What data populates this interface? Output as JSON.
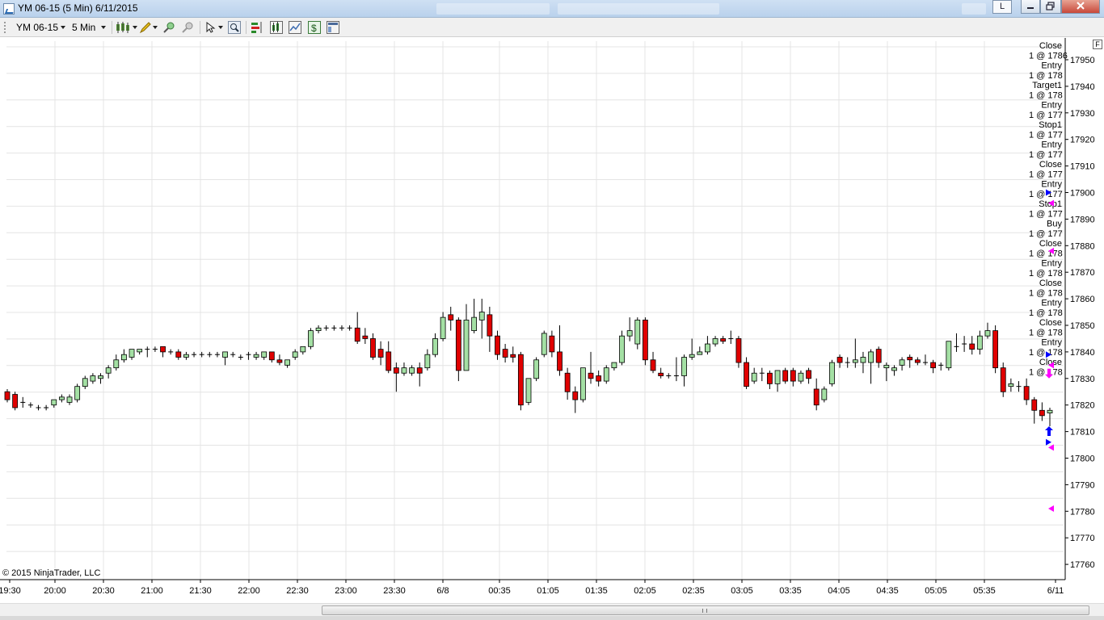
{
  "window": {
    "title": "YM 06-15 (5 Min)  6/11/2015",
    "l_button": "L"
  },
  "toolbar": {
    "instrument": "YM 06-15",
    "interval": "5 Min",
    "icons": [
      "chart-style-icon",
      "drawing-pencil-icon",
      "zoom-in-icon",
      "zoom-out-icon",
      "cursor-icon",
      "magnifier-icon",
      "strategy-icon",
      "indicator-icon",
      "data-box-icon",
      "dollar-icon",
      "properties-icon"
    ]
  },
  "chart": {
    "copyright": "© 2015 NinjaTrader, LLC",
    "panel_toggle": "F",
    "colors": {
      "up": "#a4e0a4",
      "down": "#e00000",
      "wick": "#000000",
      "grid": "#e4e4e4",
      "buy_marker": "#0000ff",
      "sell_marker": "#ff00ff"
    },
    "y_labels": [
      "17950",
      "17940",
      "17930",
      "17920",
      "17910",
      "17900",
      "17890",
      "17880",
      "17870",
      "17860",
      "17850",
      "17840",
      "17830",
      "17820",
      "17810",
      "17800",
      "17790",
      "17780",
      "17770",
      "17760"
    ],
    "x_labels": [
      "19:30",
      "20:00",
      "20:30",
      "21:00",
      "21:30",
      "22:00",
      "22:30",
      "23:00",
      "23:30",
      "6/8",
      "00:35",
      "01:05",
      "01:35",
      "02:05",
      "02:35",
      "03:05",
      "03:35",
      "04:05",
      "04:35",
      "05:05",
      "05:35",
      "6/11"
    ],
    "execution_labels": [
      "Close",
      "1 @ 1786",
      "Entry",
      "1 @ 178",
      "Target1",
      "1 @ 178",
      "Entry",
      "1 @ 177",
      "Stop1",
      "1 @ 177",
      "Entry",
      "1 @ 177",
      "Close",
      "1 @ 177",
      "Entry",
      "1 @ 177",
      "Stop1",
      "1 @ 177",
      "Buy",
      "1 @ 177",
      "Close",
      "1 @ 178",
      "Entry",
      "1 @ 178",
      "Close",
      "1 @ 178",
      "Entry",
      "1 @ 178",
      "Close",
      "1 @ 178",
      "Entry",
      "1 @ 178",
      "Close",
      "1 @ 178"
    ]
  },
  "chart_data": {
    "type": "candlestick",
    "title": "YM 06-15 (5 Min)",
    "ylim": [
      17755,
      17960
    ],
    "candles": [
      {
        "o": 17825,
        "h": 17826,
        "c": 17822,
        "l": 17821
      },
      {
        "o": 17824,
        "h": 17825,
        "c": 17819,
        "l": 17818
      },
      {
        "o": 17821,
        "h": 17823,
        "c": 17821,
        "l": 17819
      },
      {
        "o": 17820,
        "h": 17821,
        "c": 17820,
        "l": 17819
      },
      {
        "o": 17819,
        "h": 17820,
        "c": 17819,
        "l": 17818
      },
      {
        "o": 17819,
        "h": 17820,
        "c": 17819,
        "l": 17818
      },
      {
        "o": 17820,
        "h": 17822,
        "c": 17822,
        "l": 17819
      },
      {
        "o": 17822,
        "h": 17824,
        "c": 17823,
        "l": 17821
      },
      {
        "o": 17821,
        "h": 17824,
        "c": 17823,
        "l": 17820
      },
      {
        "o": 17822,
        "h": 17828,
        "c": 17827,
        "l": 17821
      },
      {
        "o": 17827,
        "h": 17831,
        "c": 17830,
        "l": 17826
      },
      {
        "o": 17829,
        "h": 17832,
        "c": 17831,
        "l": 17828
      },
      {
        "o": 17830,
        "h": 17832,
        "c": 17831,
        "l": 17828
      },
      {
        "o": 17832,
        "h": 17835,
        "c": 17834,
        "l": 17830
      },
      {
        "o": 17834,
        "h": 17839,
        "c": 17837,
        "l": 17833
      },
      {
        "o": 17837,
        "h": 17841,
        "c": 17839,
        "l": 17836
      },
      {
        "o": 17838,
        "h": 17841,
        "c": 17841,
        "l": 17837
      },
      {
        "o": 17840,
        "h": 17841,
        "c": 17841,
        "l": 17839
      },
      {
        "o": 17841,
        "h": 17842,
        "c": 17841,
        "l": 17838
      },
      {
        "o": 17841,
        "h": 17842,
        "c": 17841,
        "l": 17840
      },
      {
        "o": 17842,
        "h": 17842,
        "c": 17840,
        "l": 17838
      },
      {
        "o": 17840,
        "h": 17841,
        "c": 17840,
        "l": 17839
      },
      {
        "o": 17840,
        "h": 17841,
        "c": 17838,
        "l": 17837
      },
      {
        "o": 17838,
        "h": 17840,
        "c": 17839,
        "l": 17837
      },
      {
        "o": 17839,
        "h": 17840,
        "c": 17839,
        "l": 17838
      },
      {
        "o": 17839,
        "h": 17840,
        "c": 17839,
        "l": 17838
      },
      {
        "o": 17839,
        "h": 17840,
        "c": 17839,
        "l": 17838
      },
      {
        "o": 17839,
        "h": 17840,
        "c": 17839,
        "l": 17838
      },
      {
        "o": 17838,
        "h": 17840,
        "c": 17840,
        "l": 17835
      },
      {
        "o": 17839,
        "h": 17840,
        "c": 17839,
        "l": 17838
      },
      {
        "o": 17838,
        "h": 17839,
        "c": 17838,
        "l": 17837
      },
      {
        "o": 17839,
        "h": 17840,
        "c": 17839,
        "l": 17837
      },
      {
        "o": 17838,
        "h": 17840,
        "c": 17839,
        "l": 17837
      },
      {
        "o": 17838,
        "h": 17840,
        "c": 17840,
        "l": 17837
      },
      {
        "o": 17840,
        "h": 17840,
        "c": 17837,
        "l": 17836
      },
      {
        "o": 17837,
        "h": 17839,
        "c": 17836,
        "l": 17835
      },
      {
        "o": 17835,
        "h": 17837,
        "c": 17837,
        "l": 17834
      },
      {
        "o": 17838,
        "h": 17841,
        "c": 17840,
        "l": 17837
      },
      {
        "o": 17840,
        "h": 17842,
        "c": 17842,
        "l": 17839
      },
      {
        "o": 17842,
        "h": 17849,
        "c": 17848,
        "l": 17841
      },
      {
        "o": 17848,
        "h": 17850,
        "c": 17849,
        "l": 17847
      },
      {
        "o": 17849,
        "h": 17850,
        "c": 17849,
        "l": 17848
      },
      {
        "o": 17849,
        "h": 17850,
        "c": 17849,
        "l": 17848
      },
      {
        "o": 17849,
        "h": 17850,
        "c": 17849,
        "l": 17848
      },
      {
        "o": 17849,
        "h": 17850,
        "c": 17849,
        "l": 17848
      },
      {
        "o": 17849,
        "h": 17855,
        "c": 17844,
        "l": 17843
      },
      {
        "o": 17846,
        "h": 17849,
        "c": 17845,
        "l": 17843
      },
      {
        "o": 17845,
        "h": 17847,
        "c": 17838,
        "l": 17837
      },
      {
        "o": 17841,
        "h": 17844,
        "c": 17838,
        "l": 17835
      },
      {
        "o": 17840,
        "h": 17844,
        "c": 17833,
        "l": 17832
      },
      {
        "o": 17834,
        "h": 17836,
        "c": 17832,
        "l": 17825
      },
      {
        "o": 17832,
        "h": 17836,
        "c": 17834,
        "l": 17831
      },
      {
        "o": 17832,
        "h": 17835,
        "c": 17834,
        "l": 17831
      },
      {
        "o": 17834,
        "h": 17836,
        "c": 17832,
        "l": 17827
      },
      {
        "o": 17834,
        "h": 17841,
        "c": 17839,
        "l": 17833
      },
      {
        "o": 17839,
        "h": 17847,
        "c": 17845,
        "l": 17838
      },
      {
        "o": 17845,
        "h": 17855,
        "c": 17853,
        "l": 17844
      },
      {
        "o": 17854,
        "h": 17857,
        "c": 17852,
        "l": 17848
      },
      {
        "o": 17852,
        "h": 17853,
        "c": 17833,
        "l": 17829
      },
      {
        "o": 17833,
        "h": 17858,
        "c": 17852,
        "l": 17836
      },
      {
        "o": 17848,
        "h": 17860,
        "c": 17853,
        "l": 17847
      },
      {
        "o": 17852,
        "h": 17860,
        "c": 17855,
        "l": 17845
      },
      {
        "o": 17854,
        "h": 17857,
        "c": 17846,
        "l": 17840
      },
      {
        "o": 17846,
        "h": 17848,
        "c": 17839,
        "l": 17837
      },
      {
        "o": 17841,
        "h": 17843,
        "c": 17838,
        "l": 17836
      },
      {
        "o": 17839,
        "h": 17842,
        "c": 17838,
        "l": 17836
      },
      {
        "o": 17839,
        "h": 17840,
        "c": 17820,
        "l": 17818
      },
      {
        "o": 17821,
        "h": 17830,
        "c": 17830,
        "l": 17820
      },
      {
        "o": 17830,
        "h": 17838,
        "c": 17837,
        "l": 17829
      },
      {
        "o": 17839,
        "h": 17848,
        "c": 17847,
        "l": 17838
      },
      {
        "o": 17846,
        "h": 17848,
        "c": 17840,
        "l": 17838
      },
      {
        "o": 17840,
        "h": 17850,
        "c": 17833,
        "l": 17831
      },
      {
        "o": 17832,
        "h": 17834,
        "c": 17825,
        "l": 17822
      },
      {
        "o": 17825,
        "h": 17827,
        "c": 17822,
        "l": 17817
      },
      {
        "o": 17822,
        "h": 17834,
        "c": 17834,
        "l": 17821
      },
      {
        "o": 17832,
        "h": 17840,
        "c": 17830,
        "l": 17828
      },
      {
        "o": 17831,
        "h": 17833,
        "c": 17829,
        "l": 17827
      },
      {
        "o": 17829,
        "h": 17835,
        "c": 17834,
        "l": 17828
      },
      {
        "o": 17834,
        "h": 17836,
        "c": 17836,
        "l": 17833
      },
      {
        "o": 17836,
        "h": 17848,
        "c": 17846,
        "l": 17835
      },
      {
        "o": 17846,
        "h": 17853,
        "c": 17848,
        "l": 17844
      },
      {
        "o": 17843,
        "h": 17853,
        "c": 17852,
        "l": 17841
      },
      {
        "o": 17852,
        "h": 17853,
        "c": 17837,
        "l": 17835
      },
      {
        "o": 17837,
        "h": 17840,
        "c": 17833,
        "l": 17832
      },
      {
        "o": 17832,
        "h": 17834,
        "c": 17831,
        "l": 17830
      },
      {
        "o": 17831,
        "h": 17832,
        "c": 17831,
        "l": 17830
      },
      {
        "o": 17831,
        "h": 17838,
        "c": 17831,
        "l": 17829
      },
      {
        "o": 17831,
        "h": 17839,
        "c": 17838,
        "l": 17827
      },
      {
        "o": 17838,
        "h": 17845,
        "c": 17839,
        "l": 17837
      },
      {
        "o": 17839,
        "h": 17842,
        "c": 17840,
        "l": 17839
      },
      {
        "o": 17840,
        "h": 17846,
        "c": 17843,
        "l": 17839
      },
      {
        "o": 17843,
        "h": 17846,
        "c": 17845,
        "l": 17842
      },
      {
        "o": 17845,
        "h": 17846,
        "c": 17844,
        "l": 17843
      },
      {
        "o": 17845,
        "h": 17848,
        "c": 17845,
        "l": 17843
      },
      {
        "o": 17845,
        "h": 17846,
        "c": 17836,
        "l": 17834
      },
      {
        "o": 17836,
        "h": 17838,
        "c": 17827,
        "l": 17826
      },
      {
        "o": 17829,
        "h": 17834,
        "c": 17832,
        "l": 17828
      },
      {
        "o": 17832,
        "h": 17834,
        "c": 17832,
        "l": 17829
      },
      {
        "o": 17832,
        "h": 17833,
        "c": 17828,
        "l": 17826
      },
      {
        "o": 17828,
        "h": 17833,
        "c": 17833,
        "l": 17825
      },
      {
        "o": 17833,
        "h": 17834,
        "c": 17829,
        "l": 17828
      },
      {
        "o": 17833,
        "h": 17834,
        "c": 17829,
        "l": 17827
      },
      {
        "o": 17829,
        "h": 17833,
        "c": 17832,
        "l": 17828
      },
      {
        "o": 17833,
        "h": 17834,
        "c": 17830,
        "l": 17828
      },
      {
        "o": 17826,
        "h": 17830,
        "c": 17820,
        "l": 17818
      },
      {
        "o": 17822,
        "h": 17827,
        "c": 17826,
        "l": 17821
      },
      {
        "o": 17828,
        "h": 17837,
        "c": 17836,
        "l": 17827
      },
      {
        "o": 17838,
        "h": 17839,
        "c": 17836,
        "l": 17834
      },
      {
        "o": 17836,
        "h": 17838,
        "c": 17836,
        "l": 17834
      },
      {
        "o": 17836,
        "h": 17845,
        "c": 17837,
        "l": 17834
      },
      {
        "o": 17836,
        "h": 17840,
        "c": 17838,
        "l": 17832
      },
      {
        "o": 17836,
        "h": 17841,
        "c": 17840,
        "l": 17828
      },
      {
        "o": 17841,
        "h": 17842,
        "c": 17836,
        "l": 17834
      },
      {
        "o": 17834,
        "h": 17836,
        "c": 17835,
        "l": 17829
      },
      {
        "o": 17833,
        "h": 17835,
        "c": 17834,
        "l": 17831
      },
      {
        "o": 17835,
        "h": 17838,
        "c": 17837,
        "l": 17833
      },
      {
        "o": 17838,
        "h": 17839,
        "c": 17837,
        "l": 17834
      },
      {
        "o": 17837,
        "h": 17838,
        "c": 17836,
        "l": 17835
      },
      {
        "o": 17836,
        "h": 17839,
        "c": 17836,
        "l": 17835
      },
      {
        "o": 17836,
        "h": 17837,
        "c": 17834,
        "l": 17832
      },
      {
        "o": 17835,
        "h": 17836,
        "c": 17835,
        "l": 17833
      },
      {
        "o": 17834,
        "h": 17844,
        "c": 17844,
        "l": 17833
      },
      {
        "o": 17842,
        "h": 17847,
        "c": 17842,
        "l": 17840
      },
      {
        "o": 17843,
        "h": 17846,
        "c": 17843,
        "l": 17840
      },
      {
        "o": 17843,
        "h": 17846,
        "c": 17841,
        "l": 17839
      },
      {
        "o": 17841,
        "h": 17848,
        "c": 17846,
        "l": 17839
      },
      {
        "o": 17846,
        "h": 17851,
        "c": 17848,
        "l": 17845
      },
      {
        "o": 17848,
        "h": 17850,
        "c": 17834,
        "l": 17832
      },
      {
        "o": 17834,
        "h": 17836,
        "c": 17825,
        "l": 17823
      },
      {
        "o": 17827,
        "h": 17830,
        "c": 17828,
        "l": 17825
      },
      {
        "o": 17827,
        "h": 17829,
        "c": 17827,
        "l": 17825
      },
      {
        "o": 17827,
        "h": 17830,
        "c": 17822,
        "l": 17820
      },
      {
        "o": 17822,
        "h": 17823,
        "c": 17818,
        "l": 17813
      },
      {
        "o": 17818,
        "h": 17821,
        "c": 17816,
        "l": 17814
      },
      {
        "o": 17817,
        "h": 17819,
        "c": 17818,
        "l": 17812
      }
    ]
  }
}
